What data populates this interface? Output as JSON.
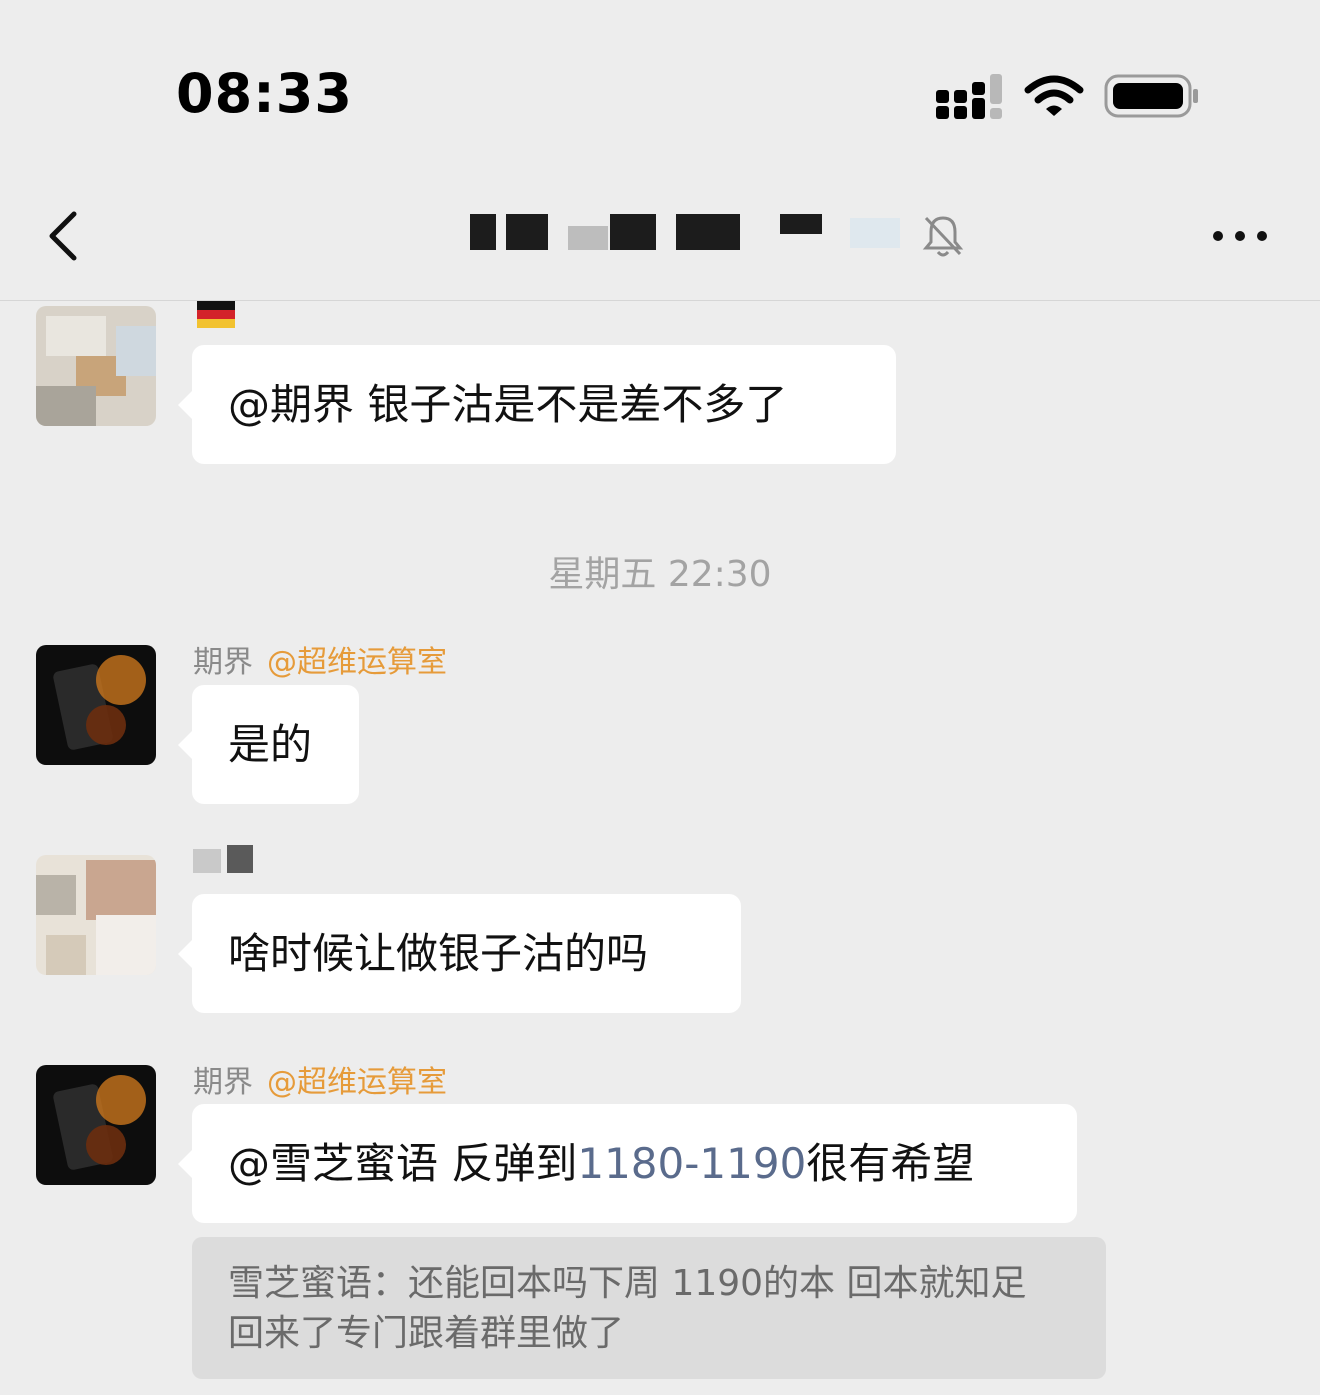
{
  "status_bar": {
    "time": "08:33"
  },
  "nav": {
    "title": "",
    "back_icon": "chevron-left-icon",
    "mute_icon": "bell-slash-icon",
    "more_icon": "ellipsis-icon"
  },
  "chat": {
    "messages": [
      {
        "sender_badge": "flag-germany",
        "text": "@期界 银子沽是不是差不多了"
      },
      {
        "timestamp": "星期五 22:30"
      },
      {
        "sender": "期界",
        "mention": "@超维运算室",
        "text": "是的"
      },
      {
        "sender": "",
        "text": "啥时候让做银子沽的吗"
      },
      {
        "sender": "期界",
        "mention": "@超维运算室",
        "text_before": "@雪芝蜜语 反弹到",
        "text_number": "1180-1190",
        "text_after": "很有希望"
      }
    ],
    "quote": {
      "text": "雪芝蜜语：还能回本吗下周  1190的本  回本就知足  回来了专门跟着群里做了"
    }
  },
  "colors": {
    "background": "#ededed",
    "bubble": "#ffffff",
    "mention": "#e69b3a",
    "quote_bg": "#dcdcdc",
    "number_link": "#5a6b8c"
  }
}
